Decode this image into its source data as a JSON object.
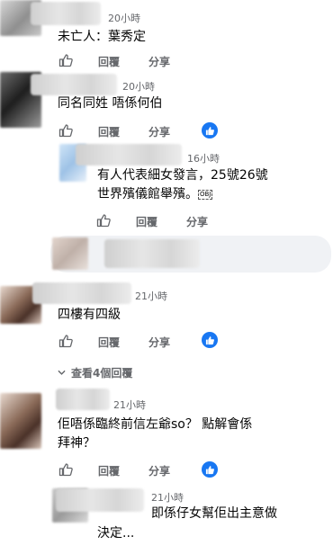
{
  "actions": {
    "like": "",
    "reply": "回覆",
    "share": "分享"
  },
  "comments": [
    {
      "time": "20小時",
      "text": "未亡人：葉秀定"
    },
    {
      "time": "20小時",
      "text": "同名同姓 唔係何伯"
    },
    {
      "time": "16小時",
      "text_line1": "有人代表細女發言，25號26號",
      "text_line2": "世界殯儀館舉殯。",
      "emoji_label": "OBJ"
    },
    {
      "time": "21小時",
      "text": "四樓有四級"
    },
    {
      "time": "21小時",
      "text_line1": "佢唔係臨終前信左爺so？ 點解會係",
      "text_line2": "拜神？"
    },
    {
      "time": "21小時",
      "text_line1": "即係仔女幫佢出主意做",
      "text_line2": "決定..."
    }
  ],
  "view_replies": "查看4個回覆",
  "colors": {
    "accent": "#1877f2",
    "meta": "#65676b",
    "text": "#050505"
  }
}
